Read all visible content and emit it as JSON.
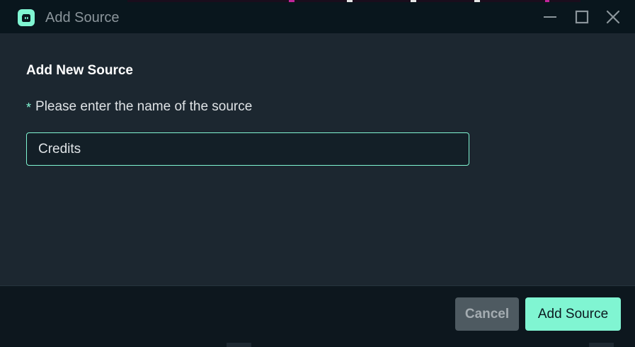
{
  "window": {
    "title": "Add Source",
    "controls": {
      "minimize": "minimize-icon",
      "maximize": "maximize-icon",
      "close": "close-icon"
    }
  },
  "form": {
    "heading": "Add New Source",
    "required_mark": "*",
    "name_label": "Please enter the name of the source",
    "name_value": "Credits"
  },
  "footer": {
    "cancel_label": "Cancel",
    "add_label": "Add Source"
  },
  "colors": {
    "accent": "#80f5d2",
    "titlebar": "#09161d",
    "content_bg": "#1c2730",
    "footer_bg": "#0d171e",
    "cancel_bg": "#4e5a61"
  }
}
